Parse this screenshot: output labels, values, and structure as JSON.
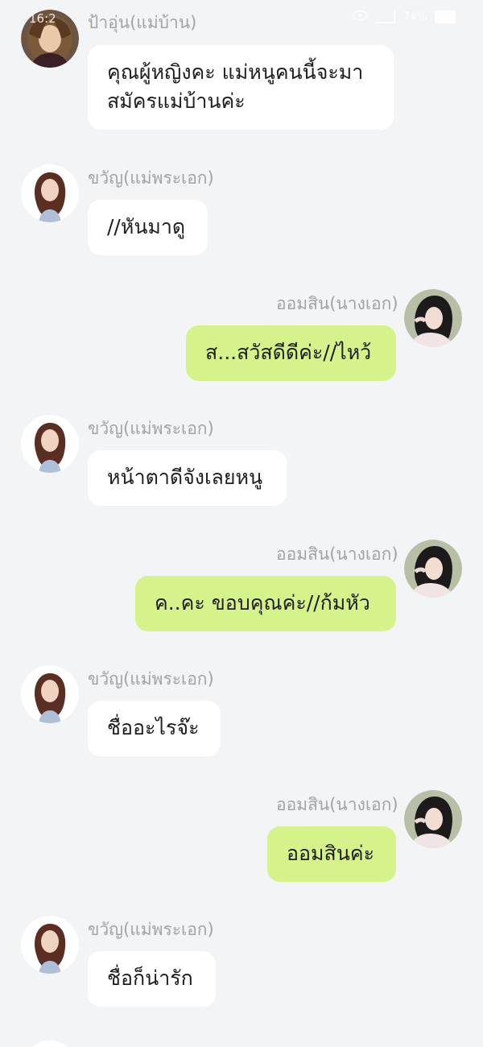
{
  "status_bar": {
    "time": "16:2",
    "battery": "74%"
  },
  "colors": {
    "background": "#f3f4f6",
    "incoming_bubble": "#ffffff",
    "outgoing_bubble": "#d5f38a",
    "name_text": "#a1a3a8",
    "message_text": "#1e1e1e"
  },
  "messages": [
    {
      "side": "left",
      "avatar": "curly-hair-avatar-icon",
      "name": "ป้าอุ่น(แม่บ้าน)",
      "text": "คุณผู้หญิงคะ แม่หนูคนนี้จะมาสมัครแม่บ้านค่ะ"
    },
    {
      "side": "left",
      "avatar": "long-hair-woman-avatar-icon",
      "name": "ขวัญ(แม่พระเอก)",
      "text": "//หันมาดู"
    },
    {
      "side": "right",
      "avatar": "girl-dark-hair-avatar-icon",
      "name": "ออมสิน(นางเอก)",
      "text": "ส...สวัสดีดีค่ะ//ไหว้"
    },
    {
      "side": "left",
      "avatar": "long-hair-woman-avatar-icon",
      "name": "ขวัญ(แม่พระเอก)",
      "text": "หน้าตาดีจังเลยหนู"
    },
    {
      "side": "right",
      "avatar": "girl-dark-hair-avatar-icon",
      "name": "ออมสิน(นางเอก)",
      "text": "ค..คะ ขอบคุณค่ะ//ก้มหัว"
    },
    {
      "side": "left",
      "avatar": "long-hair-woman-avatar-icon",
      "name": "ขวัญ(แม่พระเอก)",
      "text": "ชื่ออะไรจ๊ะ"
    },
    {
      "side": "right",
      "avatar": "girl-dark-hair-avatar-icon",
      "name": "ออมสิน(นางเอก)",
      "text": "ออมสินค่ะ"
    },
    {
      "side": "left",
      "avatar": "long-hair-woman-avatar-icon",
      "name": "ขวัญ(แม่พระเอก)",
      "text": "ชื่อก็น่ารัก"
    }
  ]
}
